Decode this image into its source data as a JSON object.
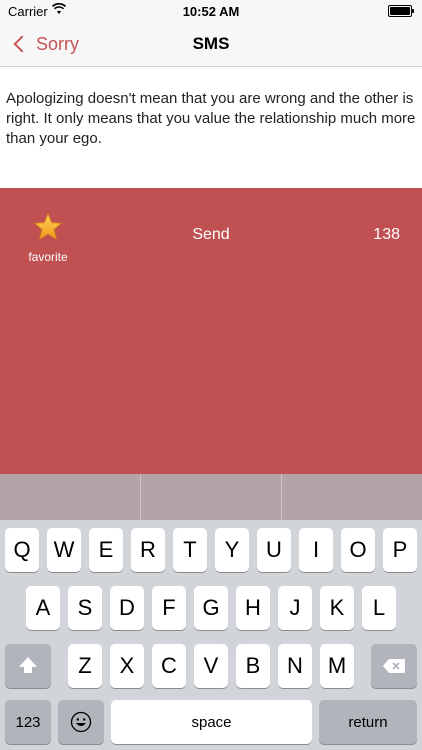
{
  "status_bar": {
    "carrier": "Carrier",
    "time": "10:52 AM"
  },
  "navbar": {
    "back_label": "Sorry",
    "title": "SMS"
  },
  "message": {
    "text": "Apologizing doesn't mean that you are wrong and the other is right. It only means that you value the relationship much more than your ego."
  },
  "actions": {
    "favorite_label": "favorite",
    "send_label": "Send",
    "char_count": "138"
  },
  "colors": {
    "accent": "#c45557",
    "panel": "#c05051",
    "prediction_bar": "#b3a4ab"
  },
  "keyboard": {
    "row1": [
      "Q",
      "W",
      "E",
      "R",
      "T",
      "Y",
      "U",
      "I",
      "O",
      "P"
    ],
    "row2": [
      "A",
      "S",
      "D",
      "F",
      "G",
      "H",
      "J",
      "K",
      "L"
    ],
    "row3": [
      "Z",
      "X",
      "C",
      "V",
      "B",
      "N",
      "M"
    ],
    "numbers_label": "123",
    "space_label": "space",
    "return_label": "return",
    "shift_icon": "shift-icon",
    "emoji_icon": "emoji-icon",
    "delete_icon": "delete-icon"
  }
}
